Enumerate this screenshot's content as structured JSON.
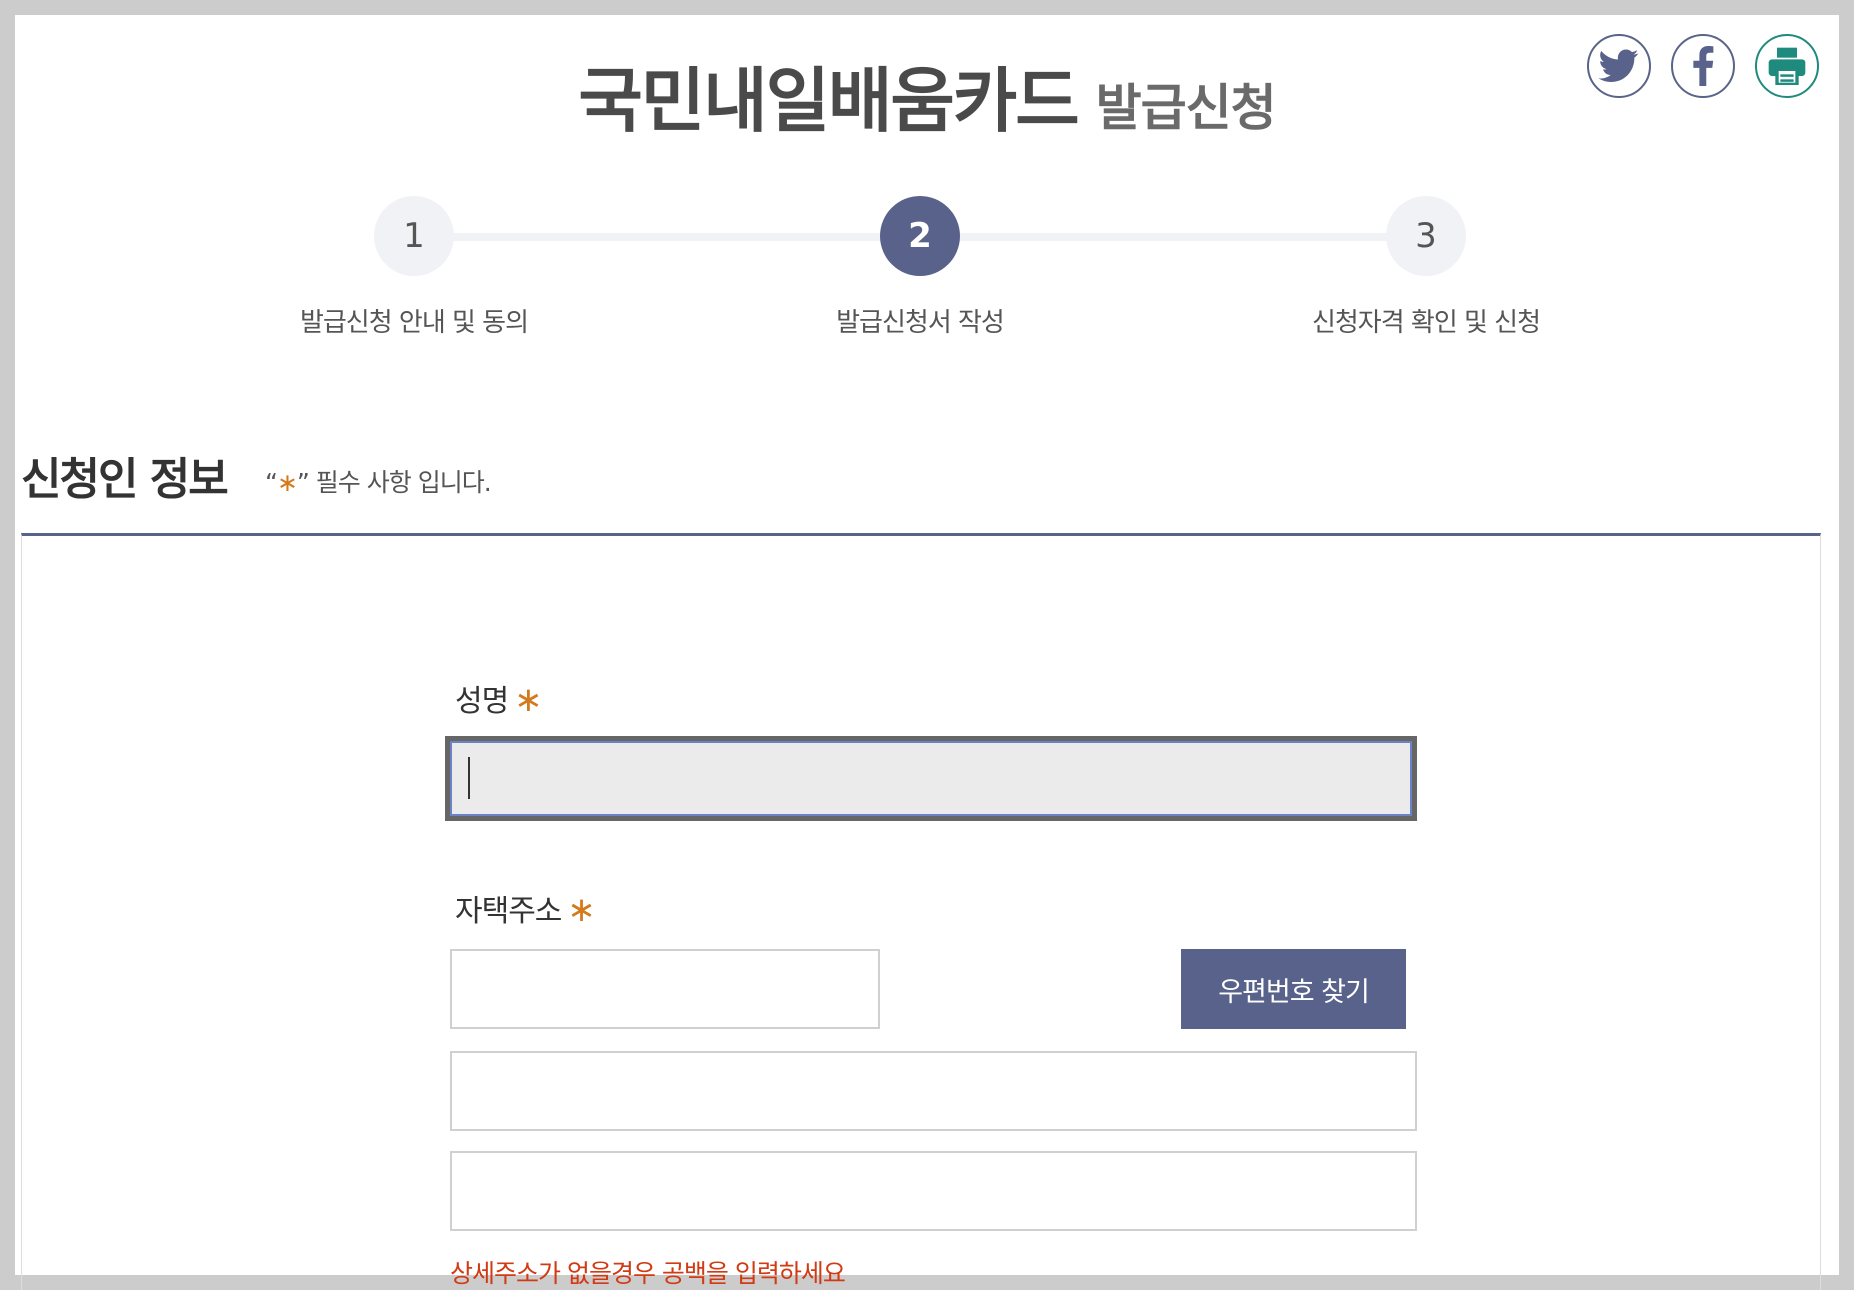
{
  "header": {
    "title_main": "국민내일배움카드",
    "title_sub": "발급신청"
  },
  "share": {
    "twitter_icon": "twitter-icon",
    "facebook_icon": "facebook-icon",
    "print_icon": "print-icon"
  },
  "colors": {
    "accent": "#59628a",
    "required_star": "#d47a1d",
    "helper_text": "#d13a12",
    "print_teal": "#1f8a7e"
  },
  "steps": [
    {
      "number": "1",
      "label": "발급신청 안내 및 동의",
      "active": false
    },
    {
      "number": "2",
      "label": "발급신청서 작성",
      "active": true
    },
    {
      "number": "3",
      "label": "신청자격 확인 및 신청",
      "active": false
    }
  ],
  "section": {
    "title": "신청인 정보",
    "note_open": "“",
    "note_star": "∗",
    "note_close": "” 필수 사항 입니다."
  },
  "form": {
    "name_label": "성명",
    "name_value": "",
    "address_label": "자택주소",
    "required_mark": "∗",
    "zip_value": "",
    "address1_value": "",
    "address2_value": "",
    "zip_button_label": "우편번호 찾기",
    "helper_text": "상세주소가 없을경우 공백을 입력하세요"
  }
}
